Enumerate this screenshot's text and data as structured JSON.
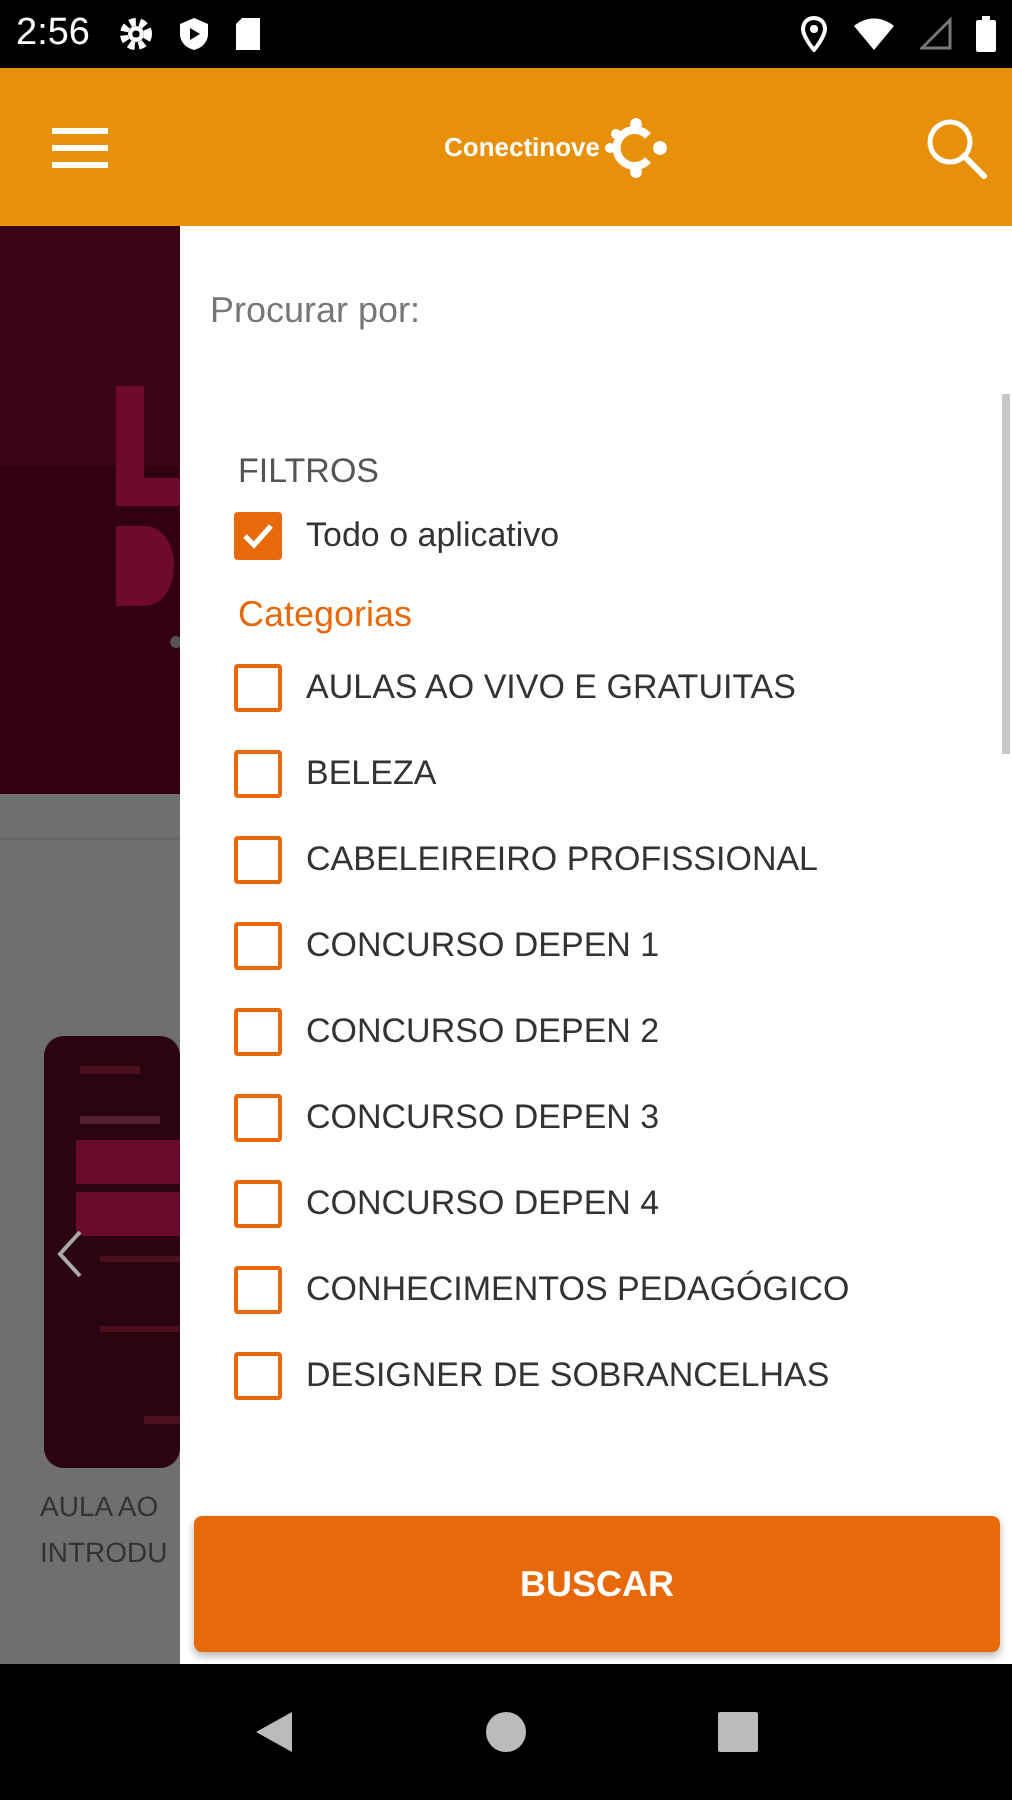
{
  "status_bar": {
    "time": "2:56"
  },
  "app_bar": {
    "logo": "Conectinove"
  },
  "background": {
    "card_caption": [
      "AULA AO",
      "INTRODU"
    ]
  },
  "drawer": {
    "search_label": "Procurar por:",
    "filters_title": "FILTROS",
    "whole_app": {
      "label": "Todo o aplicativo",
      "checked": true
    },
    "categories_title": "Categorias",
    "categories": [
      {
        "label": "AULAS AO VIVO E GRATUITAS",
        "checked": false
      },
      {
        "label": "BELEZA",
        "checked": false
      },
      {
        "label": "CABELEIREIRO PROFISSIONAL",
        "checked": false
      },
      {
        "label": "CONCURSO DEPEN 1",
        "checked": false
      },
      {
        "label": "CONCURSO DEPEN 2",
        "checked": false
      },
      {
        "label": "CONCURSO DEPEN 3",
        "checked": false
      },
      {
        "label": "CONCURSO DEPEN 4",
        "checked": false
      },
      {
        "label": "CONHECIMENTOS PEDAGÓGICO",
        "checked": false
      },
      {
        "label": "DESIGNER DE SOBRANCELHAS",
        "checked": false
      }
    ],
    "button": "BUSCAR"
  }
}
